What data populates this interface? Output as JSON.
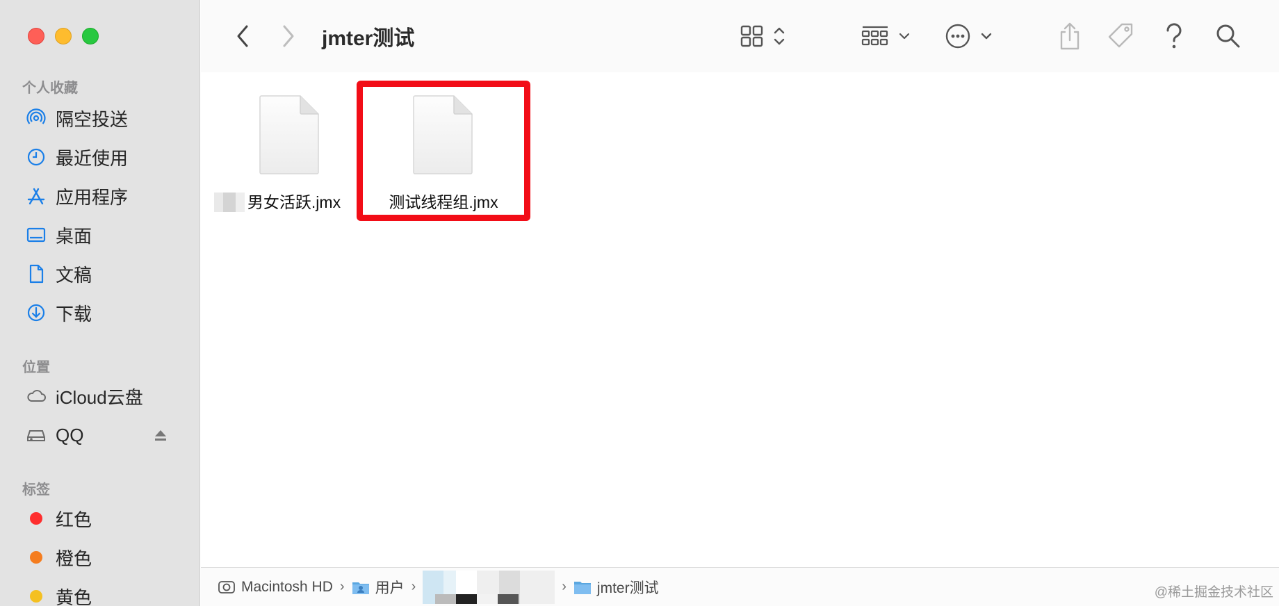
{
  "window": {
    "title": "jmter测试"
  },
  "sidebar": {
    "favorites_title": "个人收藏",
    "favorites": [
      {
        "label": "隔空投送",
        "icon": "airdrop-icon"
      },
      {
        "label": "最近使用",
        "icon": "clock-icon"
      },
      {
        "label": "应用程序",
        "icon": "applications-icon"
      },
      {
        "label": "桌面",
        "icon": "desktop-icon"
      },
      {
        "label": "文稿",
        "icon": "document-icon"
      },
      {
        "label": "下载",
        "icon": "download-icon"
      }
    ],
    "locations_title": "位置",
    "locations": [
      {
        "label": "iCloud云盘",
        "icon": "cloud-icon"
      },
      {
        "label": "QQ",
        "icon": "drive-icon"
      }
    ],
    "tags_title": "标签",
    "tags": [
      {
        "label": "红色",
        "color": "#fe2e2e"
      },
      {
        "label": "橙色",
        "color": "#f57d1f"
      },
      {
        "label": "黄色",
        "color": "#f4c021"
      }
    ]
  },
  "files": [
    {
      "name": "男女活跃.jmx",
      "icon": "document-file-icon",
      "name_partially_redacted": true
    },
    {
      "name": "测试线程组.jmx",
      "icon": "document-file-icon",
      "highlighted": true
    }
  ],
  "pathbar": {
    "items": [
      {
        "label": "Macintosh HD",
        "icon": "hard-drive-icon"
      },
      {
        "label": "用户",
        "icon": "users-folder-icon"
      },
      {
        "label": "",
        "icon": "user-home-icon",
        "redacted": true
      },
      {
        "label": "jmter测试",
        "icon": "folder-icon"
      }
    ]
  },
  "watermark": "@稀土掘金技术社区",
  "colors": {
    "highlight": "#f20d17",
    "sidebar_bg": "#e3e3e3",
    "accent": "#1a7fe8"
  }
}
